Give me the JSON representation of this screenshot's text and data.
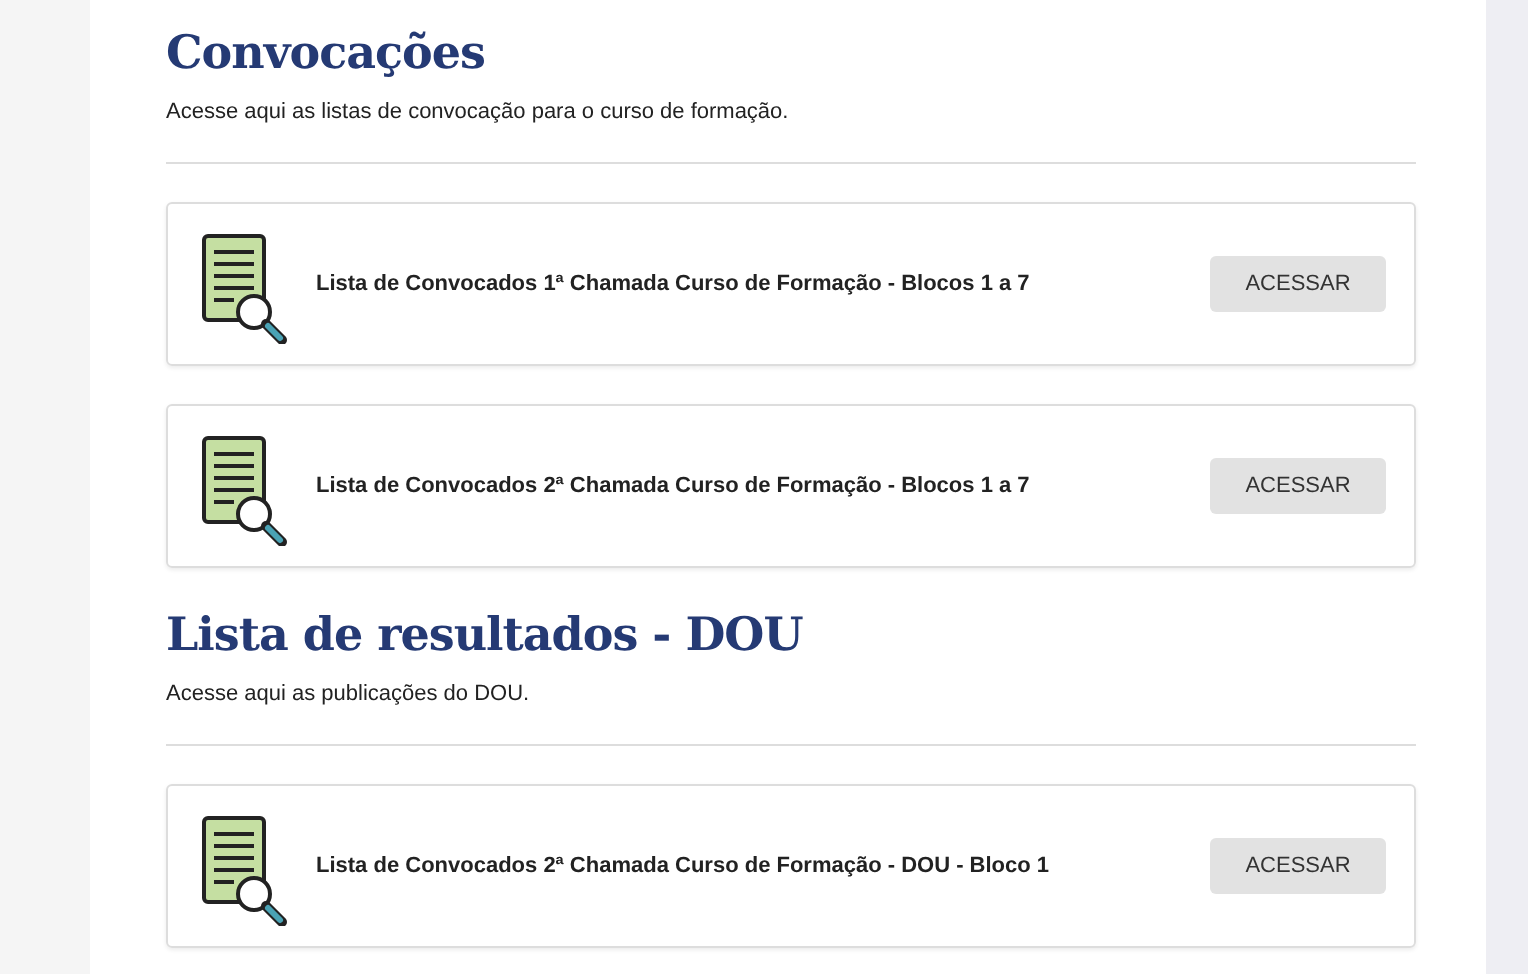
{
  "sections": [
    {
      "title": "Convocações",
      "description": "Acesse aqui as listas de convocação para o curso de formação.",
      "items": [
        {
          "label": "Lista de Convocados 1ª Chamada Curso de Formação - Blocos 1 a 7",
          "button": "ACESSAR"
        },
        {
          "label": "Lista de Convocados 2ª Chamada Curso de Formação - Blocos 1 a 7",
          "button": "ACESSAR"
        }
      ]
    },
    {
      "title": "Lista de resultados - DOU",
      "description": "Acesse aqui as publicações do DOU.",
      "items": [
        {
          "label": "Lista de Convocados 2ª Chamada Curso de Formação - DOU - Bloco 1",
          "button": "ACESSAR"
        }
      ]
    }
  ]
}
